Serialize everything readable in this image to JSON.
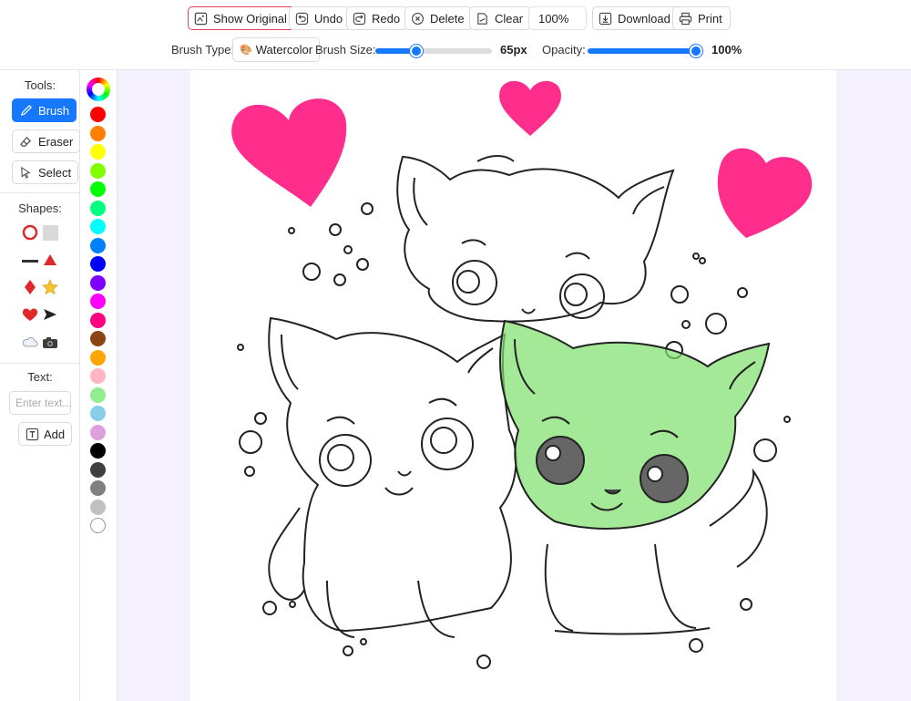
{
  "toolbar": {
    "show_original": "Show Original",
    "undo": "Undo",
    "redo": "Redo",
    "delete": "Delete",
    "clear": "Clear",
    "zoom": "100%",
    "download": "Download",
    "print": "Print"
  },
  "settings": {
    "brush_type_label": "Brush Type:",
    "brush_type_value": "Watercolor",
    "brush_size_label": "Brush Size:",
    "brush_size_value": "65px",
    "brush_size_fraction": 0.33,
    "opacity_label": "Opacity:",
    "opacity_value": "100%",
    "opacity_fraction": 1.0
  },
  "tools": {
    "heading": "Tools:",
    "brush": "Brush",
    "eraser": "Eraser",
    "select": "Select",
    "active": "Brush"
  },
  "shapes": {
    "heading": "Shapes:",
    "items": [
      "circle-outline",
      "square",
      "line",
      "triangle",
      "diamond",
      "star",
      "heart",
      "arrow",
      "cloud",
      "camera"
    ]
  },
  "text": {
    "heading": "Text:",
    "placeholder": "Enter text...",
    "add": "Add"
  },
  "palette": {
    "colors": [
      "#ff0000",
      "#ff7f00",
      "#ffff00",
      "#80ff00",
      "#00ff00",
      "#00ff80",
      "#00ffff",
      "#0080ff",
      "#0000ff",
      "#8000ff",
      "#ff00ff",
      "#ff0080",
      "#8b4513",
      "#ffa500",
      "#ffb6c1",
      "#90ee90",
      "#87ceeb",
      "#dda0dd",
      "#000000",
      "#404040",
      "#808080",
      "#c0c0c0",
      "#ffffff"
    ],
    "accent": "#1677ff",
    "canvas_bg": "#f5f0fd"
  }
}
